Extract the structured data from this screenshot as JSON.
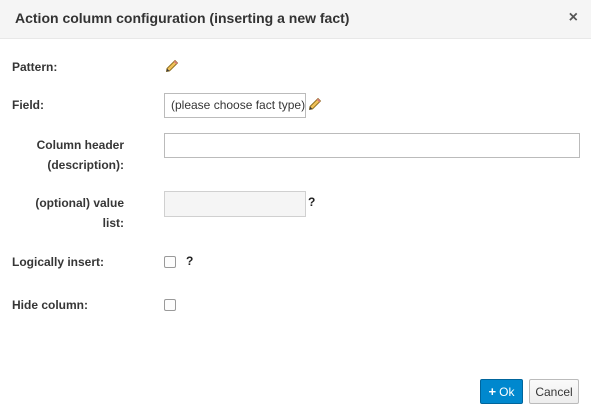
{
  "dialog": {
    "title": "Action column configuration (inserting a new fact)",
    "close_glyph": "×"
  },
  "form": {
    "pattern_label": "Pattern:",
    "field_label": "Field:",
    "field_value": "(please choose fact type)",
    "column_header_label_line1": "Column header",
    "column_header_label_line2": "(description):",
    "column_header_value": "",
    "value_list_label_line1": "(optional) value",
    "value_list_label_line2": "list:",
    "value_list_value": "",
    "value_list_help": "?",
    "logically_insert_label": "Logically insert:",
    "logically_insert_checked": false,
    "logically_insert_help": "?",
    "hide_column_label": "Hide column:",
    "hide_column_checked": false
  },
  "footer": {
    "ok_label": "Ok",
    "ok_icon": "plus-icon",
    "cancel_label": "Cancel"
  },
  "icons": {
    "edit": "pencil-icon"
  },
  "colors": {
    "primary": "#0088ce",
    "header_bg": "#f5f5f5"
  }
}
